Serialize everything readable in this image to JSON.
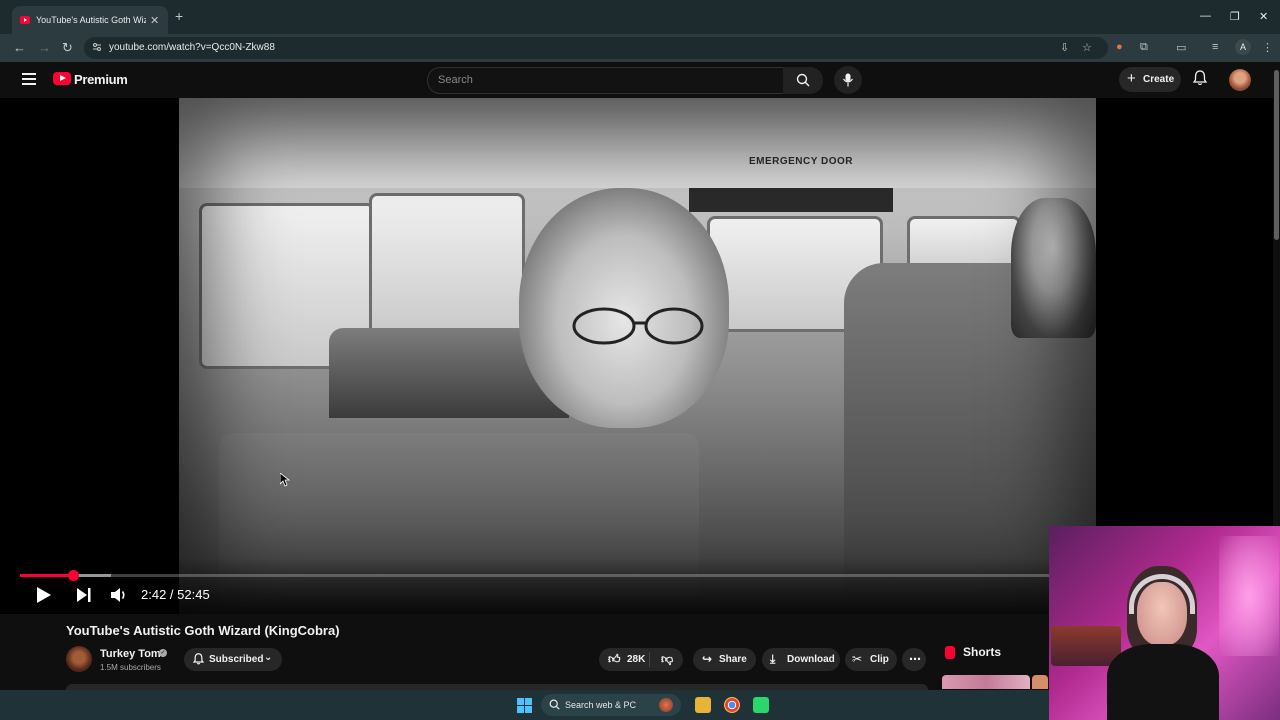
{
  "browser": {
    "tab_title": "YouTube's Autistic Goth Wizard",
    "url": "youtube.com/watch?v=Qcc0N-Zkw88",
    "profile_initial": "A"
  },
  "masthead": {
    "logo_text": "Premium",
    "search_placeholder": "Search",
    "create_label": "Create"
  },
  "video": {
    "sign_text": "EMERGENCY DOOR",
    "time_display": "2:42 / 52:45",
    "progress_fraction": 0.0512,
    "buffered_fraction": 0.088
  },
  "details": {
    "title": "YouTube's Autistic Goth Wizard (KingCobra)",
    "channel_name": "Turkey Tom",
    "subscribers": "1.5M subscribers",
    "subscribed_label": "Subscribed",
    "likes": "28K",
    "share_label": "Share",
    "download_label": "Download",
    "clip_label": "Clip",
    "shorts_label": "Shorts"
  },
  "taskbar": {
    "search_label": "Search web & PC"
  },
  "colors": {
    "accent": "#ff0033",
    "background": "#0f0f0f",
    "chrome": "#2c3b3f",
    "taskbar": "#1e3238"
  }
}
